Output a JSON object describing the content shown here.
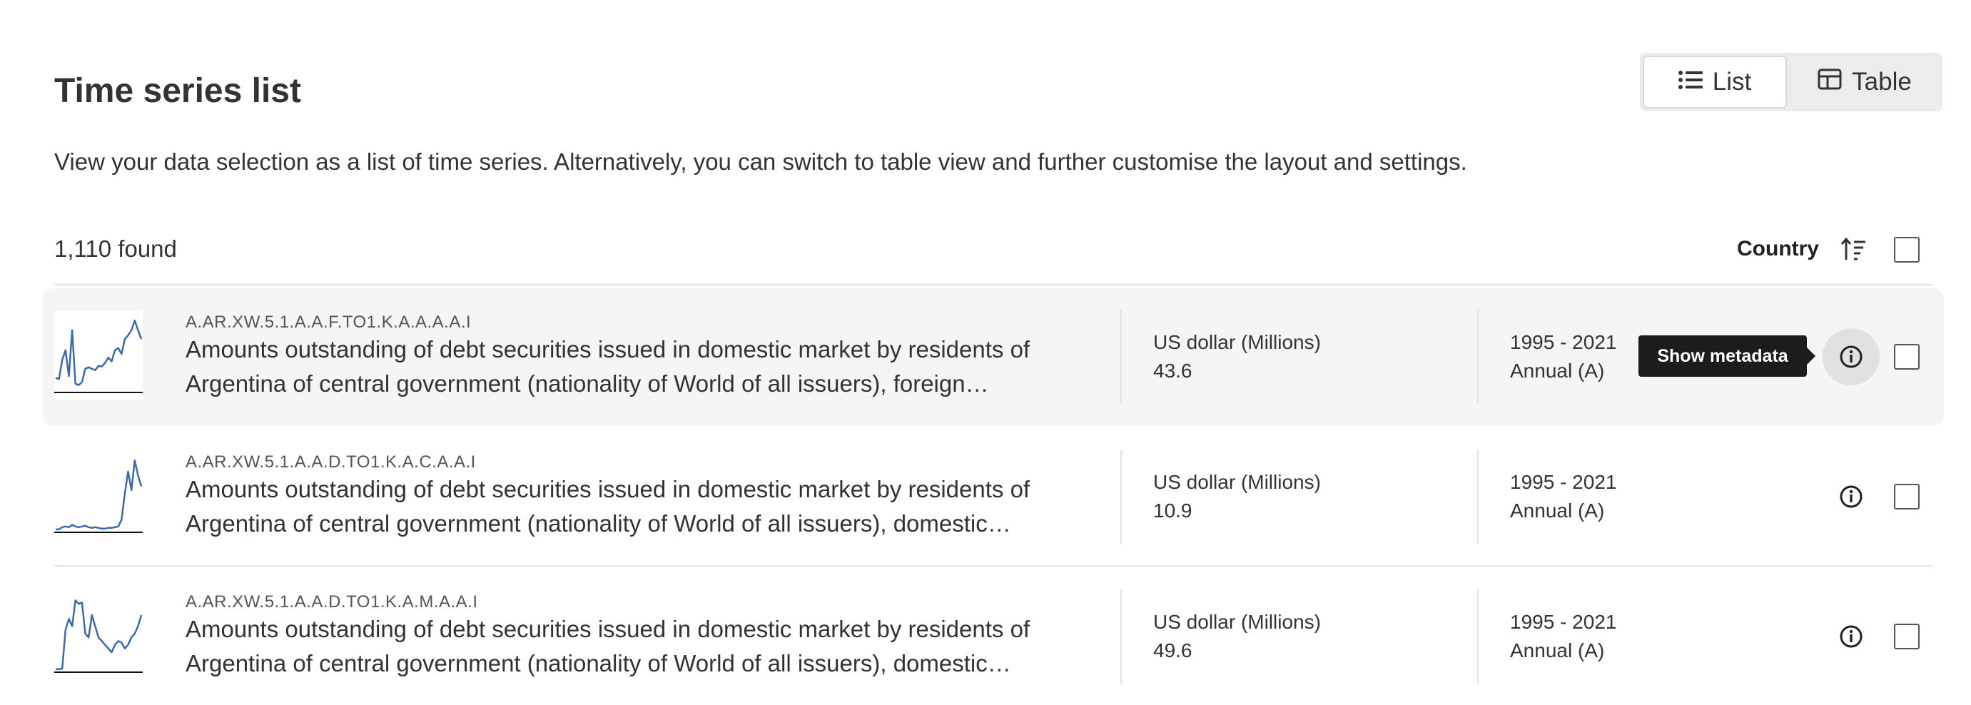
{
  "header": {
    "title": "Time series list",
    "description": "View your data selection as a list of time series. Alternatively, you can switch to table view and further customise the layout and settings."
  },
  "view_toggle": {
    "list_label": "List",
    "table_label": "Table",
    "selected": "List"
  },
  "results": {
    "found": "1,110 found",
    "sort_label": "Country"
  },
  "tooltip": "Show metadata",
  "colors": {
    "accent": "#3d6aa5",
    "tooltip_bg": "#1c1c1c"
  },
  "series": [
    {
      "code": "A.AR.XW.5.1.A.A.F.TO1.K.A.A.A.A.I",
      "description_line1": "Amounts outstanding of debt securities issued in domestic market by residents of",
      "description_line2": "Argentina of central government (nationality of World of all issuers), foreign…",
      "unit": "US dollar (Millions)",
      "value": "43.6",
      "period": "1995 - 2021",
      "frequency": "Annual (A)",
      "sparkline": [
        0.18,
        0.16,
        0.42,
        0.55,
        0.2,
        0.82,
        0.1,
        0.08,
        0.12,
        0.3,
        0.32,
        0.3,
        0.28,
        0.34,
        0.33,
        0.38,
        0.45,
        0.4,
        0.55,
        0.58,
        0.5,
        0.7,
        0.75,
        0.82,
        0.95,
        0.82,
        0.7
      ]
    },
    {
      "code": "A.AR.XW.5.1.A.A.D.TO1.K.A.C.A.A.I",
      "description_line1": "Amounts outstanding of debt securities issued in domestic market by residents of",
      "description_line2": "Argentina of central government (nationality of World of all issuers), domestic…",
      "unit": "US dollar (Millions)",
      "value": "10.9",
      "period": "1995 - 2021",
      "frequency": "Annual (A)",
      "sparkline": [
        0.02,
        0.02,
        0.05,
        0.06,
        0.05,
        0.08,
        0.06,
        0.05,
        0.06,
        0.07,
        0.05,
        0.04,
        0.05,
        0.04,
        0.03,
        0.03,
        0.04,
        0.04,
        0.05,
        0.06,
        0.15,
        0.5,
        0.8,
        0.55,
        0.95,
        0.75,
        0.6
      ]
    },
    {
      "code": "A.AR.XW.5.1.A.A.D.TO1.K.A.M.A.A.I",
      "description_line1": "Amounts outstanding of debt securities issued in domestic market by residents of",
      "description_line2": "Argentina of central government (nationality of World of all issuers), domestic…",
      "unit": "US dollar (Millions)",
      "value": "49.6",
      "period": "1995 - 2021",
      "frequency": "Annual (A)",
      "sparkline": [
        0.02,
        0.02,
        0.03,
        0.55,
        0.7,
        0.6,
        0.95,
        0.9,
        0.92,
        0.5,
        0.45,
        0.75,
        0.6,
        0.45,
        0.4,
        0.35,
        0.3,
        0.25,
        0.35,
        0.4,
        0.38,
        0.3,
        0.35,
        0.45,
        0.5,
        0.6,
        0.75
      ]
    }
  ]
}
